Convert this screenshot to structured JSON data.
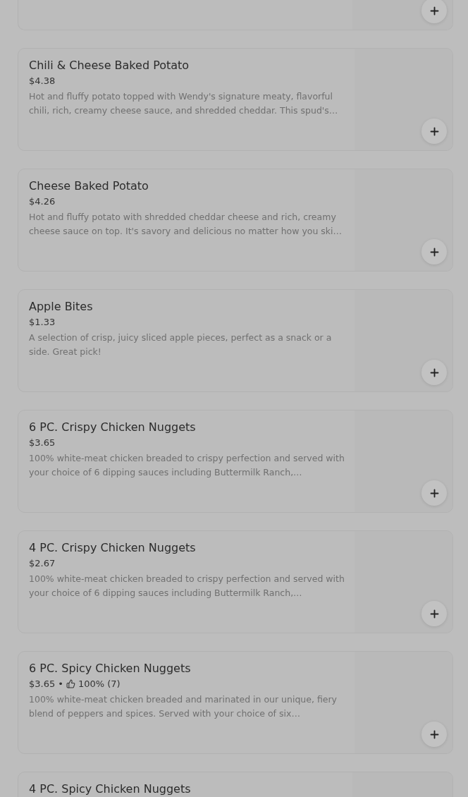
{
  "items": [
    {
      "kind": "cut-top"
    },
    {
      "kind": "full",
      "name": "Chili & Cheese Baked Potato",
      "price": "$4.38",
      "description": "Hot and fluffy potato topped with Wendy's signature meaty, flavorful chili, rich, creamy cheese sauce, and shredded cheddar. This spud's…"
    },
    {
      "kind": "full",
      "name": "Cheese Baked Potato",
      "price": "$4.26",
      "description": "Hot and fluffy potato with shredded cheddar cheese and rich, creamy cheese sauce on top. It's savory and delicious no matter how you ski…"
    },
    {
      "kind": "full",
      "name": "Apple Bites",
      "price": "$1.33",
      "description": "A selection of crisp, juicy sliced apple pieces, perfect as a snack or a side. Great pick!"
    },
    {
      "kind": "full",
      "name": "6 PC. Crispy Chicken Nuggets",
      "price": "$3.65",
      "description": "100% white-meat chicken breaded to crispy perfection and served with your choice of 6 dipping sauces including Buttermilk Ranch,…"
    },
    {
      "kind": "full",
      "name": "4 PC. Crispy Chicken Nuggets",
      "price": "$2.67",
      "description": "100% white-meat chicken breaded to crispy perfection and served with your choice of 6 dipping sauces including Buttermilk Ranch,…"
    },
    {
      "kind": "full",
      "name": "6 PC. Spicy Chicken Nuggets",
      "price": "$3.65",
      "separator": "•",
      "rating": "100% (7)",
      "description": "100% white-meat chicken breaded and marinated in our unique, fiery blend of peppers and spices. Served with your choice of six…"
    },
    {
      "kind": "cut-bottom",
      "name": "4 PC. Spicy Chicken Nuggets"
    }
  ]
}
